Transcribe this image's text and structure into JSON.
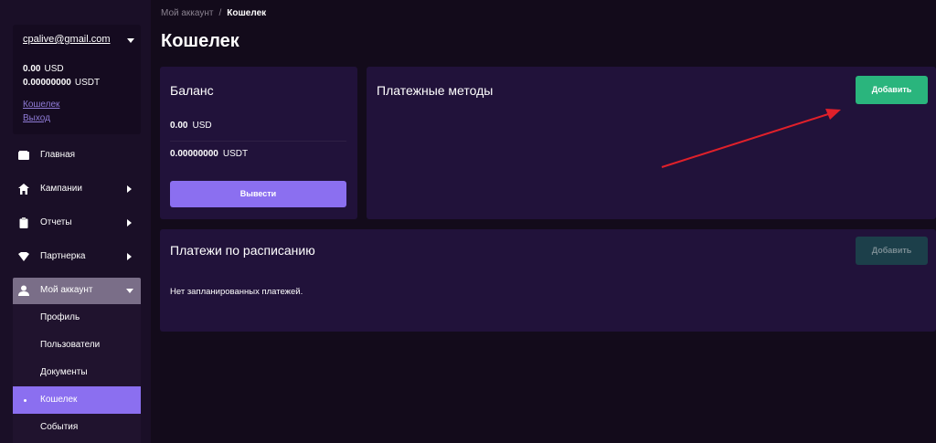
{
  "account": {
    "email": "cpalive@gmail.com",
    "balance_usd_amount": "0.00",
    "balance_usd_currency": "USD",
    "balance_usdt_amount": "0.00000000",
    "balance_usdt_currency": "USDT",
    "wallet_link": "Кошелек",
    "logout_link": "Выход"
  },
  "nav": {
    "home": "Главная",
    "campaigns": "Кампании",
    "reports": "Отчеты",
    "partners": "Партнерка",
    "my_account": "Мой аккаунт",
    "sub": {
      "profile": "Профиль",
      "users": "Пользователи",
      "documents": "Документы",
      "wallet": "Кошелек",
      "events": "События"
    }
  },
  "breadcrumb": {
    "parent": "Мой аккаунт",
    "separator": "/",
    "current": "Кошелек"
  },
  "page": {
    "title": "Кошелек"
  },
  "balance_card": {
    "title": "Баланс",
    "usd_amount": "0.00",
    "usd_currency": "USD",
    "usdt_amount": "0.00000000",
    "usdt_currency": "USDT",
    "withdraw_label": "Вывести"
  },
  "payment_methods": {
    "title": "Платежные методы",
    "add_label": "Добавить"
  },
  "scheduled": {
    "title": "Платежи по расписанию",
    "add_label": "Добавить",
    "empty_text": "Нет запланированных платежей."
  },
  "colors": {
    "background": "#130b1b",
    "card": "#21123a",
    "accent_purple": "#8b6ff0",
    "accent_green": "#2ab57d",
    "annotation_arrow": "#e0202a"
  }
}
